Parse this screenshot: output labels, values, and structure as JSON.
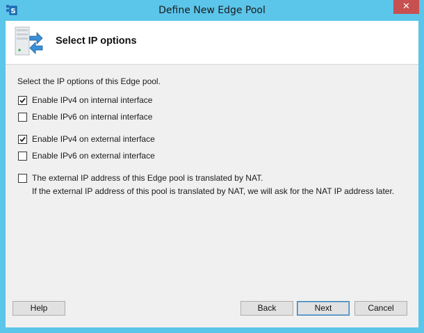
{
  "window": {
    "title": "Define New Edge Pool",
    "close_label": "✕"
  },
  "header": {
    "title": "Select IP options"
  },
  "instructions": "Select the IP options of this Edge pool.",
  "options": [
    {
      "label": "Enable IPv4 on internal interface",
      "checked": true
    },
    {
      "label": "Enable IPv6 on internal interface",
      "checked": false
    },
    {
      "label": "Enable IPv4 on external interface",
      "checked": true
    },
    {
      "label": "Enable IPv6 on external interface",
      "checked": false
    },
    {
      "label": "The external IP address of this Edge pool is translated by NAT.",
      "checked": false
    }
  ],
  "nat_note": "If the external IP address of this pool is translated by NAT, we will ask for the NAT IP address later.",
  "buttons": {
    "help": "Help",
    "back": "Back",
    "next": "Next",
    "cancel": "Cancel"
  },
  "colors": {
    "title_bar": "#5bc5ea",
    "close_button": "#c75050",
    "default_button_border": "#3c7fb1"
  }
}
